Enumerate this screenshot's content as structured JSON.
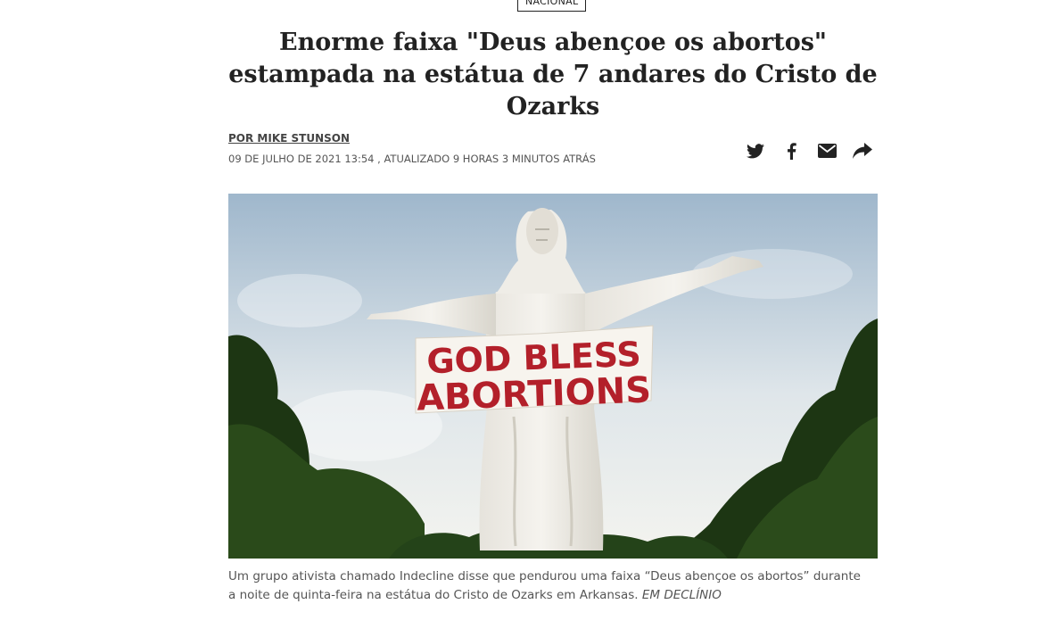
{
  "section": {
    "tag": "NACIONAL"
  },
  "article": {
    "headline": "Enorme faixa \"Deus abençoe os abortos\" estampada na estátua de 7 andares do Cristo de Ozarks",
    "byline": "POR MIKE STUNSON",
    "dateline": "09 DE JULHO DE 2021 13:54 ,  ATUALIZADO 9 HORAS 3 MINUTOS ATRÁS"
  },
  "share": {
    "icons": [
      "twitter-icon",
      "facebook-icon",
      "email-icon",
      "share-icon"
    ]
  },
  "photo": {
    "banner_line1": "GOD BLESS",
    "banner_line2": "ABORTIONS"
  },
  "caption": {
    "text": "Um grupo ativista chamado Indecline disse que pendurou uma faixa “Deus abençoe os abortos” durante a noite de quinta-feira na estátua do Cristo de Ozarks em Arkansas.",
    "credit": "EM DECLÍNIO"
  },
  "colors": {
    "sky_top": "#a9bfd2",
    "sky_bottom": "#eef2f2",
    "statue": "#ece9e2",
    "banner_text": "#b3202a",
    "trees": "#1f3a14"
  }
}
